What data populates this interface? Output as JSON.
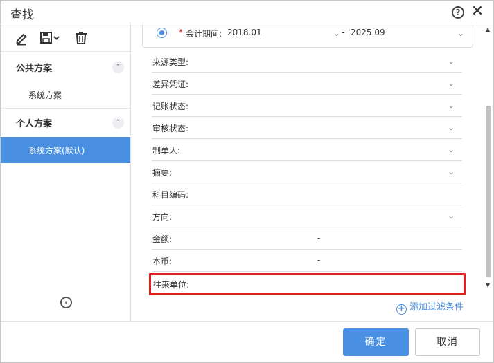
{
  "dialog": {
    "title": "查找"
  },
  "sidebar": {
    "public_section": {
      "title": "公共方案",
      "toggle": "⌃",
      "items": [
        {
          "label": "系统方案"
        }
      ]
    },
    "personal_section": {
      "title": "个人方案",
      "toggle": "⌃",
      "items": [
        {
          "label": "系统方案(默认)",
          "active": true
        }
      ]
    }
  },
  "filters": {
    "period": {
      "required_mark": "*",
      "label": "会计期间:",
      "start": "2018.01",
      "separator": "-",
      "end": "2025.09"
    },
    "fields": [
      {
        "label": "来源类型:",
        "type": "select"
      },
      {
        "label": "差异凭证:",
        "type": "select"
      },
      {
        "label": "记账状态:",
        "type": "select"
      },
      {
        "label": "审核状态:",
        "type": "select"
      },
      {
        "label": "制单人:",
        "type": "select"
      },
      {
        "label": "摘要:",
        "type": "select"
      },
      {
        "label": "科目编码:",
        "type": "text"
      },
      {
        "label": "方向:",
        "type": "select"
      },
      {
        "label": "金额:",
        "type": "range",
        "separator": "-"
      },
      {
        "label": "本币:",
        "type": "range",
        "separator": "-"
      },
      {
        "label": "往来单位:",
        "type": "text",
        "highlighted": true
      }
    ],
    "add_filter_label": "添加过滤条件"
  },
  "footer": {
    "ok_label": "确定",
    "cancel_label": "取消"
  },
  "colors": {
    "accent": "#4a90e2",
    "highlight_border": "#e02020"
  },
  "icons": [
    "help-icon",
    "close-icon",
    "edit-icon",
    "save-icon",
    "trash-icon",
    "collapse-sidebar-icon",
    "add-circle-icon"
  ]
}
